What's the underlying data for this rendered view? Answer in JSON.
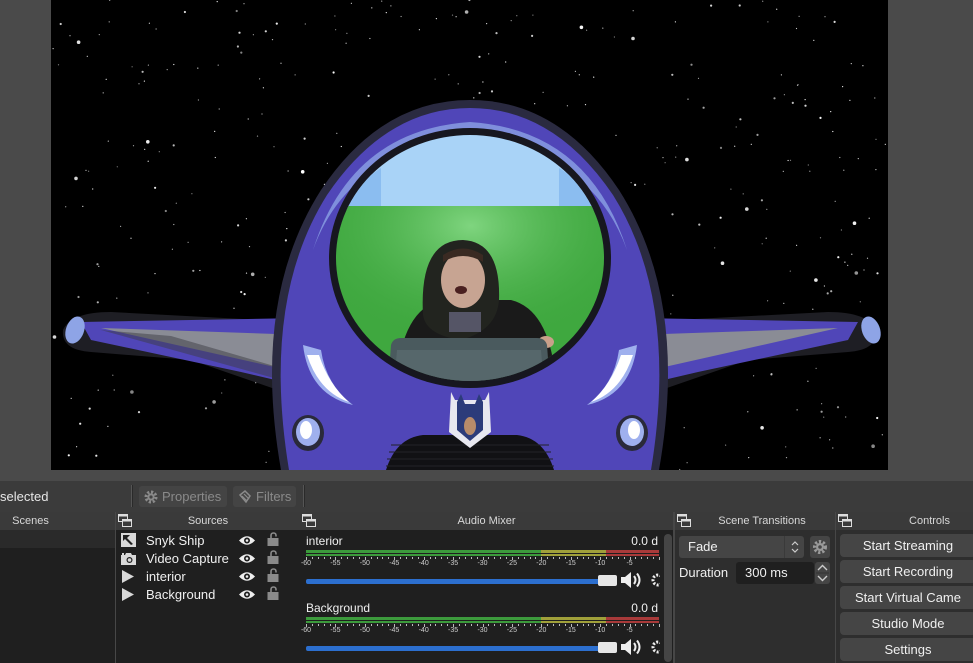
{
  "preview": {
    "scene_description": "Snyk spaceship cockpit over starfield with presenter in window",
    "colors": {
      "ship_body": "#5046b8",
      "ship_highlight": "#7f8fdc",
      "ship_wing_stripe": "#8a8c95",
      "window_sky": "#a9d3f7",
      "window_green": "#3fa83f",
      "space": "#000000",
      "ui_background": "#4a4a4a"
    }
  },
  "source_toolbar": {
    "no_source_label": "selected",
    "properties_label": "Properties",
    "filters_label": "Filters"
  },
  "docks": {
    "scenes": {
      "title": "Scenes"
    },
    "sources": {
      "title": "Sources",
      "items": [
        {
          "name": "Snyk Ship",
          "icon": "image-icon",
          "visible": true,
          "locked": false
        },
        {
          "name": "Video Capture",
          "icon": "camera-icon",
          "visible": true,
          "locked": false
        },
        {
          "name": "interior",
          "icon": "media-play-icon",
          "visible": true,
          "locked": false
        },
        {
          "name": "Background",
          "icon": "media-play-icon",
          "visible": true,
          "locked": false
        }
      ]
    },
    "audio_mixer": {
      "title": "Audio Mixer",
      "channels": [
        {
          "name": "interior",
          "level": "0.0 d",
          "volume_fraction": 1.0,
          "muted": false
        },
        {
          "name": "Background",
          "level": "0.0 d",
          "volume_fraction": 1.0,
          "muted": false
        }
      ],
      "tick_labels": [
        "-60",
        "-55",
        "-50",
        "-45",
        "-40",
        "-35",
        "-30",
        "-25",
        "-20",
        "-15",
        "-10",
        "-5"
      ],
      "meter_colors": {
        "green": "#3c9a3c",
        "yellow": "#a0a03a",
        "red": "#a83a3a",
        "slider": "#2c6fcf"
      }
    },
    "scene_transitions": {
      "title": "Scene Transitions",
      "transition": "Fade",
      "duration_label": "Duration",
      "duration_value": "300 ms"
    },
    "controls": {
      "title": "Controls",
      "buttons": [
        "Start Streaming",
        "Start Recording",
        "Start Virtual Came",
        "Studio Mode",
        "Settings"
      ]
    }
  }
}
